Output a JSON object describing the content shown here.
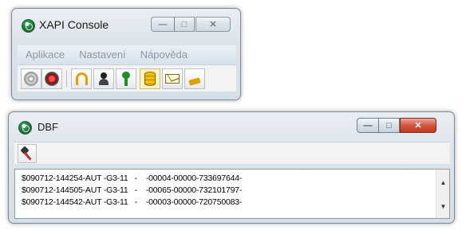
{
  "xapi_window": {
    "title": "XAPI Console",
    "menu": [
      "Aplikace",
      "Nastavení",
      "Nápověda"
    ],
    "toolbar_icons": [
      "cd-icon",
      "record-icon",
      "horseshoe-icon",
      "user-icon",
      "key-icon",
      "database-icon",
      "mail-icon",
      "xml-icon"
    ],
    "pressed_index": 5
  },
  "dbf_window": {
    "title": "DBF",
    "toolbar_icons": [
      "tools-icon"
    ],
    "rows": [
      "$090712-144254-AUT -G3-11   -    -00004-00000-733697644-",
      "$090712-144505-AUT -G3-11   -    -00065-00000-732101797-",
      "$090712-144542-AUT -G3-11   -    -00003-00000-720750083-"
    ]
  },
  "colors": {
    "menu_text": "#8e98a3",
    "close_button": "#d4553d",
    "pressed_button": "#fdf3c8"
  }
}
